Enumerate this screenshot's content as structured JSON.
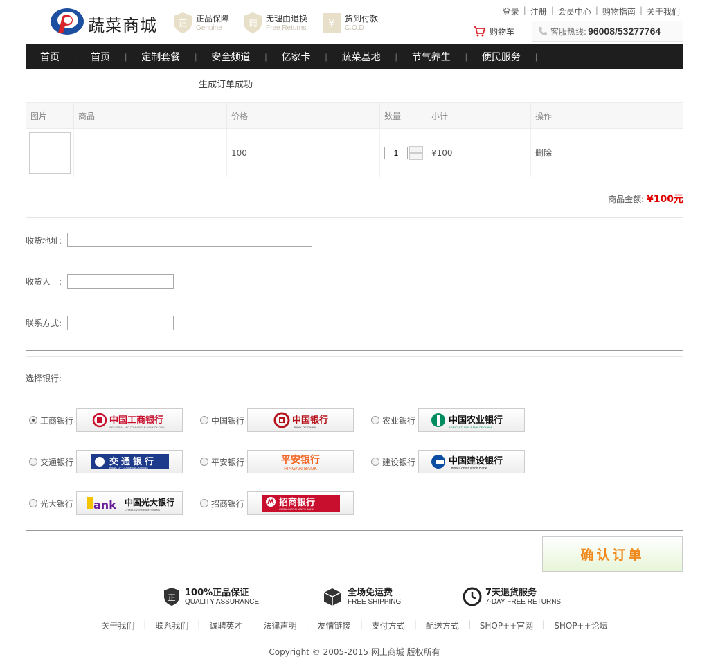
{
  "header": {
    "logo_text": "蔬菜商城",
    "guarantees": [
      {
        "title": "正品保障",
        "subtitle": "Genuine",
        "glyph": "正"
      },
      {
        "title": "无理由退换",
        "subtitle": "Free Returns",
        "glyph": "调"
      },
      {
        "title": "货到付款",
        "subtitle": "C.O.D",
        "glyph": "¥"
      }
    ],
    "top_links": [
      "登录",
      "注册",
      "会员中心",
      "购物指南",
      "关于我们"
    ],
    "cart_label": "购物车",
    "hotline_label": "客服热线:",
    "hotline_number": "96008/53277764"
  },
  "nav": {
    "items": [
      "首页",
      "首页",
      "定制套餐",
      "安全频道",
      "亿家卡",
      "蔬菜基地",
      "节气养生",
      "便民服务"
    ]
  },
  "order": {
    "success_message": "生成订单成功",
    "columns": [
      "图片",
      "商品",
      "价格",
      "数量",
      "小计",
      "操作"
    ],
    "rows": [
      {
        "product": "",
        "price": "100",
        "quantity": "1",
        "subtotal": "¥100",
        "action": "删除"
      }
    ],
    "total_label": "商品金额:",
    "total_value": "¥100元"
  },
  "form": {
    "address_label": "收货地址:",
    "receiver_label": "收货人　:",
    "contact_label": "联系方式:",
    "address_value": "",
    "receiver_value": "",
    "contact_value": ""
  },
  "banks": {
    "title": "选择银行:",
    "selected": "工商银行",
    "items": [
      {
        "name": "工商银行",
        "logo_cn": "中国工商银行",
        "logo_en": "INDUSTRIAL AND COMMERCIAL BANK OF CHINA",
        "color": "#c8102e"
      },
      {
        "name": "中国银行",
        "logo_cn": "中国银行",
        "logo_en": "BANK OF CHINA",
        "color": "#b5121b"
      },
      {
        "name": "农业银行",
        "logo_cn": "中国农业银行",
        "logo_en": "AGRICULTURAL BANK OF CHINA",
        "color": "#008c5e"
      },
      {
        "name": "交通银行",
        "logo_cn": "交通银行",
        "logo_en": "BANK OF COMMUNICATIONS",
        "color": "#1e3a8a"
      },
      {
        "name": "平安银行",
        "logo_cn": "平安银行",
        "logo_en": "PINGAN BANK",
        "color": "#f26522"
      },
      {
        "name": "建设银行",
        "logo_cn": "中国建设银行",
        "logo_en": "China Construction Bank",
        "color": "#0a4da2"
      },
      {
        "name": "光大银行",
        "logo_cn": "中国光大银行",
        "logo_en": "CHINA EVERBRIGHT BANK",
        "color": "#6a1b9a"
      },
      {
        "name": "招商银行",
        "logo_cn": "招商银行",
        "logo_en": "CHINA MERCHANTS BANK",
        "color": "#c8102e"
      }
    ]
  },
  "confirm_label": "确认订单",
  "services": [
    {
      "title": "100%正品保证",
      "subtitle": "QUALITY ASSURANCE"
    },
    {
      "title": "全场免运费",
      "subtitle": "FREE SHIPPING"
    },
    {
      "title": "7天退货服务",
      "subtitle": "7-DAY FREE RETURNS"
    }
  ],
  "footer": {
    "links": [
      "关于我们",
      "联系我们",
      "诚聘英才",
      "法律声明",
      "友情链接",
      "支付方式",
      "配送方式",
      "SHOP++官网",
      "SHOP++论坛"
    ],
    "copyright": "Copyright © 2005-2015 网上商城 版权所有"
  }
}
